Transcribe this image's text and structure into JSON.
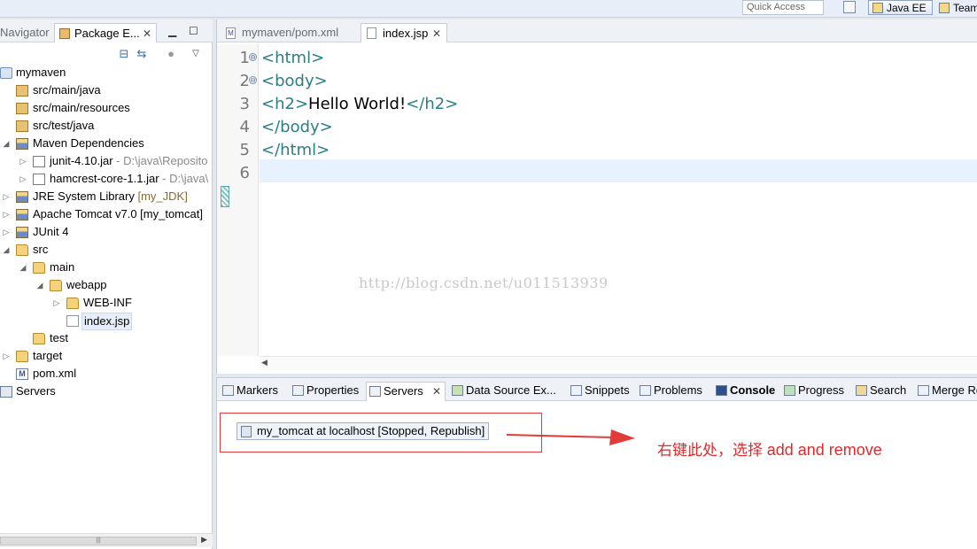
{
  "toolbar": {
    "quick_access_placeholder": "Quick Access",
    "perspective_active": "Java EE",
    "perspective_other": "Team"
  },
  "left_panel": {
    "tabs": [
      {
        "label": "Navigator"
      },
      {
        "label": "Package E..."
      }
    ],
    "tree": [
      {
        "label": "mymaven",
        "icon": "project-icon"
      },
      {
        "label": "src/main/java",
        "icon": "source-folder-icon"
      },
      {
        "label": "src/main/resources",
        "icon": "source-folder-icon"
      },
      {
        "label": "src/test/java",
        "icon": "source-folder-icon"
      },
      {
        "label": "Maven Dependencies",
        "icon": "library-icon"
      },
      {
        "label": "junit-4.10.jar",
        "decoration": " - D:\\java\\Reposito",
        "icon": "jar-icon"
      },
      {
        "label": "hamcrest-core-1.1.jar",
        "decoration": " - D:\\java\\",
        "icon": "jar-icon"
      },
      {
        "label": "JRE System Library",
        "decoration": " [my_JDK]",
        "icon": "library-icon"
      },
      {
        "label": "Apache Tomcat v7.0 [my_tomcat]",
        "icon": "library-icon"
      },
      {
        "label": "JUnit 4",
        "icon": "library-icon"
      },
      {
        "label": "src",
        "icon": "folder-icon"
      },
      {
        "label": "main",
        "icon": "folder-icon"
      },
      {
        "label": "webapp",
        "icon": "folder-icon"
      },
      {
        "label": "WEB-INF",
        "icon": "folder-icon"
      },
      {
        "label": "index.jsp",
        "icon": "file-icon"
      },
      {
        "label": "test",
        "icon": "folder-icon"
      },
      {
        "label": "target",
        "icon": "folder-icon"
      },
      {
        "label": "pom.xml",
        "icon": "xml-file-icon"
      },
      {
        "label": "Servers",
        "icon": "server-icon"
      }
    ],
    "scroll_thumb": "|||"
  },
  "editor": {
    "tabs": [
      {
        "label": "mymaven/pom.xml"
      },
      {
        "label": "index.jsp"
      }
    ],
    "line_numbers": [
      "1",
      "2",
      "3",
      "4",
      "5",
      "6"
    ],
    "lines": [
      {
        "open": "<html>",
        "text": "",
        "close": ""
      },
      {
        "open": "<body>",
        "text": "",
        "close": ""
      },
      {
        "open": "<h2>",
        "text": "Hello World!",
        "close": "</h2>"
      },
      {
        "open": "</body>",
        "text": "",
        "close": ""
      },
      {
        "open": "</html>",
        "text": "",
        "close": ""
      },
      {
        "open": "",
        "text": "",
        "close": ""
      }
    ],
    "fold_marker": "⊖"
  },
  "watermark": "http://blog.csdn.net/u011513939",
  "bottom_panel": {
    "tabs": [
      {
        "label": "Markers"
      },
      {
        "label": "Properties"
      },
      {
        "label": "Servers"
      },
      {
        "label": "Data Source Ex..."
      },
      {
        "label": "Snippets"
      },
      {
        "label": "Problems"
      },
      {
        "label": "Console"
      },
      {
        "label": "Progress"
      },
      {
        "label": "Search"
      },
      {
        "label": "Merge Re"
      }
    ],
    "server_entry": "my_tomcat at localhost  [Stopped, Republish]"
  },
  "annotation": {
    "prefix": "右键此处，选择 ",
    "highlight": "add and remove",
    "color": "#e12a2a"
  },
  "colors": {
    "tag": "#2b7d86",
    "current_line": "#e8f2fe"
  }
}
